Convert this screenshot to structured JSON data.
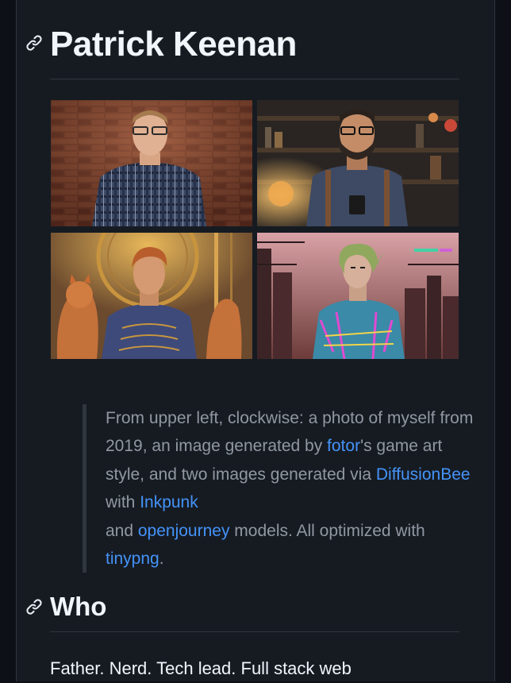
{
  "heading": "Patrick Keenan",
  "gallery": [
    {
      "label": "photo-2019"
    },
    {
      "label": "fotor-game-art"
    },
    {
      "label": "diffusionbee-openjourney"
    },
    {
      "label": "diffusionbee-inkpunk"
    }
  ],
  "caption": {
    "t1": "From upper left, clockwise: a photo of myself from 2019, an image generated by ",
    "link_fotor": "fotor",
    "t2": "'s game art style, and two images generated via ",
    "link_diffusionbee": "DiffusionBee",
    "t3": " with ",
    "link_inkpunk": "Inkpunk",
    "t4": " and ",
    "link_openjourney": "openjourney",
    "t5": " models. All optimized with ",
    "link_tinypng": "tinypng",
    "t6": "."
  },
  "who_heading": "Who",
  "who_text": "Father. Nerd. Tech lead. Full stack web",
  "colors": {
    "link": "#4493f8",
    "background": "#161b22",
    "border": "#30363d",
    "muted_text": "#9198a1"
  },
  "icons": {
    "anchor": "link-icon"
  }
}
